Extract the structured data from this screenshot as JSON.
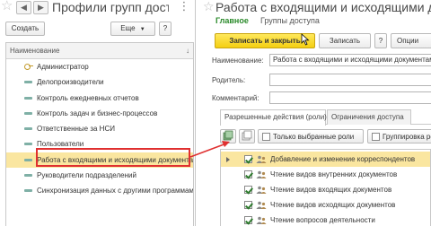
{
  "left_panel": {
    "title": "Профили групп доступа",
    "create_label": "Создать",
    "more_label": "Еще",
    "more_icon": "chevron-down-icon",
    "help_label": "?",
    "column_header": "Наименование",
    "rows": [
      {
        "label": "Администратор",
        "icon": "key-icon"
      },
      {
        "label": "Делопроизводители",
        "icon": "item-icon"
      },
      {
        "label": "Контроль ежедневных отчетов",
        "icon": "item-icon"
      },
      {
        "label": "Контроль задач и бизнес-процессов",
        "icon": "item-icon"
      },
      {
        "label": "Ответственные за НСИ",
        "icon": "item-icon"
      },
      {
        "label": "Пользователи",
        "icon": "item-icon"
      },
      {
        "label": "Работа с входящими и исходящими документами",
        "icon": "item-icon",
        "selected": true
      },
      {
        "label": "Руководители подразделений",
        "icon": "item-icon"
      },
      {
        "label": "Синхронизация данных с другими программами",
        "icon": "item-icon"
      }
    ]
  },
  "right_panel": {
    "title": "Работа с входящими и исходящими документами",
    "tabs": {
      "main": "Главное",
      "other": "Группы доступа"
    },
    "save_close_label": "Записать и закрыть",
    "save_label": "Записать",
    "help_label": "?",
    "options_label": "Опции",
    "fields": {
      "name_label": "Наименование:",
      "name_value": "Работа с входящими и исходящими документами",
      "parent_label": "Родитель:",
      "parent_value": "",
      "comment_label": "Комментарий:",
      "comment_value": ""
    },
    "inner_tabs": [
      {
        "label": "Разрешенные действия (роли)",
        "active": true
      },
      {
        "label": "Ограничения доступа",
        "active": false
      }
    ],
    "roles_toolbar": {
      "only_selected_label": "Только выбранные роли",
      "grouping_label": "Группировка ролей"
    },
    "roles": [
      {
        "label": "Добавление и изменение корреспондентов",
        "checked": true,
        "selected": true
      },
      {
        "label": "Чтение видов внутренних документов",
        "checked": true
      },
      {
        "label": "Чтение видов входящих документов",
        "checked": true
      },
      {
        "label": "Чтение видов исходящих документов",
        "checked": true
      },
      {
        "label": "Чтение вопросов деятельности",
        "checked": true
      }
    ]
  },
  "colors": {
    "accent_yellow": "#f4cf12",
    "selection": "#fae6a0",
    "highlight_red": "#e03030",
    "main_tab_green": "#2a8a2a"
  }
}
